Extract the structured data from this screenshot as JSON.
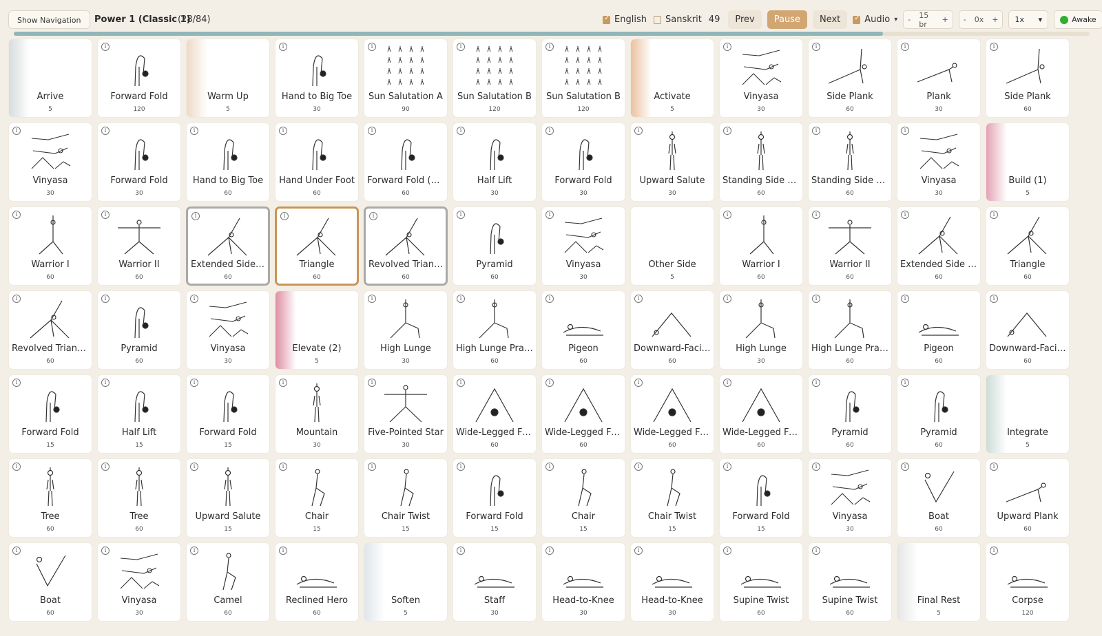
{
  "header": {
    "nav_button": "Show Navigation",
    "sequence_title": "Power 1 (Classic 1)",
    "position": "(28/84)",
    "english_label": "English",
    "english_checked": true,
    "sanskrit_label": "Sanskrit",
    "sanskrit_checked": false,
    "count": "49",
    "prev": "Prev",
    "pause": "Pause",
    "next": "Next",
    "audio_label": "Audio",
    "audio_checked": true,
    "breath_stepper": {
      "minus": "-",
      "value": "15 br",
      "plus": "+"
    },
    "offset_stepper": {
      "minus": "-",
      "value": "0x",
      "plus": "+"
    },
    "speed": "1x",
    "awake": "Awake",
    "progress": 0.808
  },
  "colors": {
    "accent": "#d2a673",
    "selected_border": "#a9a9a9",
    "current_border": "#c99555",
    "awake": "#2fb02f"
  },
  "cards": [
    {
      "name": "Arrive",
      "duration": "5",
      "type": "section",
      "color": "#d7dcdc"
    },
    {
      "name": "Forward Fold",
      "duration": "120",
      "type": "pose",
      "icon": "fold"
    },
    {
      "name": "Warm Up",
      "duration": "5",
      "type": "section",
      "color": "#efd9c6"
    },
    {
      "name": "Hand to Big Toe",
      "duration": "30",
      "type": "pose",
      "icon": "fold"
    },
    {
      "name": "Sun Salutation A",
      "duration": "90",
      "type": "pose",
      "icon": "grid"
    },
    {
      "name": "Sun Salutation B",
      "duration": "120",
      "type": "pose",
      "icon": "grid"
    },
    {
      "name": "Sun Salutation B",
      "duration": "120",
      "type": "pose",
      "icon": "grid"
    },
    {
      "name": "Activate",
      "duration": "5",
      "type": "section",
      "color": "#ecc09f"
    },
    {
      "name": "Vinyasa",
      "duration": "30",
      "type": "pose",
      "icon": "vinyasa"
    },
    {
      "name": "Side Plank",
      "duration": "60",
      "type": "pose",
      "icon": "sideplank"
    },
    {
      "name": "Plank",
      "duration": "30",
      "type": "pose",
      "icon": "plank"
    },
    {
      "name": "Side Plank",
      "duration": "60",
      "type": "pose",
      "icon": "sideplank"
    },
    {
      "name": "Vinyasa",
      "duration": "30",
      "type": "pose",
      "icon": "vinyasa"
    },
    {
      "name": "Forward Fold",
      "duration": "30",
      "type": "pose",
      "icon": "fold"
    },
    {
      "name": "Hand to Big Toe",
      "duration": "60",
      "type": "pose",
      "icon": "fold"
    },
    {
      "name": "Hand Under Foot",
      "duration": "60",
      "type": "pose",
      "icon": "fold"
    },
    {
      "name": "Forward Fold (Ar...",
      "duration": "60",
      "type": "pose",
      "icon": "fold"
    },
    {
      "name": "Half Lift",
      "duration": "30",
      "type": "pose",
      "icon": "fold"
    },
    {
      "name": "Forward Fold",
      "duration": "30",
      "type": "pose",
      "icon": "fold"
    },
    {
      "name": "Upward Salute",
      "duration": "30",
      "type": "pose",
      "icon": "stand"
    },
    {
      "name": "Standing Side Be...",
      "duration": "60",
      "type": "pose",
      "icon": "stand"
    },
    {
      "name": "Standing Side Be...",
      "duration": "60",
      "type": "pose",
      "icon": "stand"
    },
    {
      "name": "Vinyasa",
      "duration": "30",
      "type": "pose",
      "icon": "vinyasa"
    },
    {
      "name": "Build (1)",
      "duration": "5",
      "type": "section",
      "color": "#e3a3b4"
    },
    {
      "name": "Warrior I",
      "duration": "60",
      "type": "pose",
      "icon": "warrior"
    },
    {
      "name": "Warrior II",
      "duration": "60",
      "type": "pose",
      "icon": "warrior2"
    },
    {
      "name": "Extended Side An...",
      "duration": "60",
      "type": "pose",
      "icon": "triangle",
      "state": "sel"
    },
    {
      "name": "Triangle",
      "duration": "60",
      "type": "pose",
      "icon": "triangle",
      "state": "cur"
    },
    {
      "name": "Revolved Triangle",
      "duration": "60",
      "type": "pose",
      "icon": "triangle",
      "state": "sel"
    },
    {
      "name": "Pyramid",
      "duration": "60",
      "type": "pose",
      "icon": "fold"
    },
    {
      "name": "Vinyasa",
      "duration": "30",
      "type": "pose",
      "icon": "vinyasa"
    },
    {
      "name": "Other Side",
      "duration": "5",
      "type": "blank"
    },
    {
      "name": "Warrior I",
      "duration": "60",
      "type": "pose",
      "icon": "warrior"
    },
    {
      "name": "Warrior II",
      "duration": "60",
      "type": "pose",
      "icon": "warrior2"
    },
    {
      "name": "Extended Side An...",
      "duration": "60",
      "type": "pose",
      "icon": "triangle"
    },
    {
      "name": "Triangle",
      "duration": "60",
      "type": "pose",
      "icon": "triangle"
    },
    {
      "name": "Revolved Triangle",
      "duration": "60",
      "type": "pose",
      "icon": "triangle"
    },
    {
      "name": "Pyramid",
      "duration": "60",
      "type": "pose",
      "icon": "fold"
    },
    {
      "name": "Vinyasa",
      "duration": "30",
      "type": "pose",
      "icon": "vinyasa"
    },
    {
      "name": "Elevate (2)",
      "duration": "5",
      "type": "section",
      "color": "#df8fa5"
    },
    {
      "name": "High Lunge",
      "duration": "30",
      "type": "pose",
      "icon": "lunge"
    },
    {
      "name": "High Lunge Praye...",
      "duration": "60",
      "type": "pose",
      "icon": "lunge"
    },
    {
      "name": "Pigeon",
      "duration": "60",
      "type": "pose",
      "icon": "floor"
    },
    {
      "name": "Downward-Facin...",
      "duration": "60",
      "type": "pose",
      "icon": "dog"
    },
    {
      "name": "High Lunge",
      "duration": "30",
      "type": "pose",
      "icon": "lunge"
    },
    {
      "name": "High Lunge Praye...",
      "duration": "60",
      "type": "pose",
      "icon": "lunge"
    },
    {
      "name": "Pigeon",
      "duration": "60",
      "type": "pose",
      "icon": "floor"
    },
    {
      "name": "Downward-Facin...",
      "duration": "60",
      "type": "pose",
      "icon": "dog"
    },
    {
      "name": "Forward Fold",
      "duration": "15",
      "type": "pose",
      "icon": "fold"
    },
    {
      "name": "Half Lift",
      "duration": "15",
      "type": "pose",
      "icon": "fold"
    },
    {
      "name": "Forward Fold",
      "duration": "15",
      "type": "pose",
      "icon": "fold"
    },
    {
      "name": "Mountain",
      "duration": "30",
      "type": "pose",
      "icon": "stand"
    },
    {
      "name": "Five-Pointed Star",
      "duration": "30",
      "type": "pose",
      "icon": "star"
    },
    {
      "name": "Wide-Legged For...",
      "duration": "60",
      "type": "pose",
      "icon": "wide"
    },
    {
      "name": "Wide-Legged For...",
      "duration": "60",
      "type": "pose",
      "icon": "wide"
    },
    {
      "name": "Wide-Legged For...",
      "duration": "60",
      "type": "pose",
      "icon": "wide"
    },
    {
      "name": "Wide-Legged For...",
      "duration": "60",
      "type": "pose",
      "icon": "wide"
    },
    {
      "name": "Pyramid",
      "duration": "60",
      "type": "pose",
      "icon": "fold"
    },
    {
      "name": "Pyramid",
      "duration": "60",
      "type": "pose",
      "icon": "fold"
    },
    {
      "name": "Integrate",
      "duration": "5",
      "type": "section",
      "color": "#cfdcd6"
    },
    {
      "name": "Tree",
      "duration": "60",
      "type": "pose",
      "icon": "stand"
    },
    {
      "name": "Tree",
      "duration": "60",
      "type": "pose",
      "icon": "stand"
    },
    {
      "name": "Upward Salute",
      "duration": "15",
      "type": "pose",
      "icon": "stand"
    },
    {
      "name": "Chair",
      "duration": "15",
      "type": "pose",
      "icon": "chair"
    },
    {
      "name": "Chair Twist",
      "duration": "15",
      "type": "pose",
      "icon": "chair"
    },
    {
      "name": "Forward Fold",
      "duration": "15",
      "type": "pose",
      "icon": "fold"
    },
    {
      "name": "Chair",
      "duration": "15",
      "type": "pose",
      "icon": "chair"
    },
    {
      "name": "Chair Twist",
      "duration": "15",
      "type": "pose",
      "icon": "chair"
    },
    {
      "name": "Forward Fold",
      "duration": "15",
      "type": "pose",
      "icon": "fold"
    },
    {
      "name": "Vinyasa",
      "duration": "30",
      "type": "pose",
      "icon": "vinyasa"
    },
    {
      "name": "Boat",
      "duration": "60",
      "type": "pose",
      "icon": "boat"
    },
    {
      "name": "Upward Plank",
      "duration": "60",
      "type": "pose",
      "icon": "plank"
    },
    {
      "name": "Boat",
      "duration": "60",
      "type": "pose",
      "icon": "boat"
    },
    {
      "name": "Vinyasa",
      "duration": "30",
      "type": "pose",
      "icon": "vinyasa"
    },
    {
      "name": "Camel",
      "duration": "60",
      "type": "pose",
      "icon": "chair"
    },
    {
      "name": "Reclined Hero",
      "duration": "60",
      "type": "pose",
      "icon": "floor"
    },
    {
      "name": "Soften",
      "duration": "5",
      "type": "section",
      "color": "#dfe6ea"
    },
    {
      "name": "Staff",
      "duration": "30",
      "type": "pose",
      "icon": "floor"
    },
    {
      "name": "Head-to-Knee",
      "duration": "30",
      "type": "pose",
      "icon": "floor"
    },
    {
      "name": "Head-to-Knee",
      "duration": "30",
      "type": "pose",
      "icon": "floor"
    },
    {
      "name": "Supine Twist",
      "duration": "60",
      "type": "pose",
      "icon": "floor"
    },
    {
      "name": "Supine Twist",
      "duration": "60",
      "type": "pose",
      "icon": "floor"
    },
    {
      "name": "Final Rest",
      "duration": "5",
      "type": "section",
      "color": "#e6e6e6"
    },
    {
      "name": "Corpse",
      "duration": "120",
      "type": "pose",
      "icon": "floor"
    }
  ]
}
